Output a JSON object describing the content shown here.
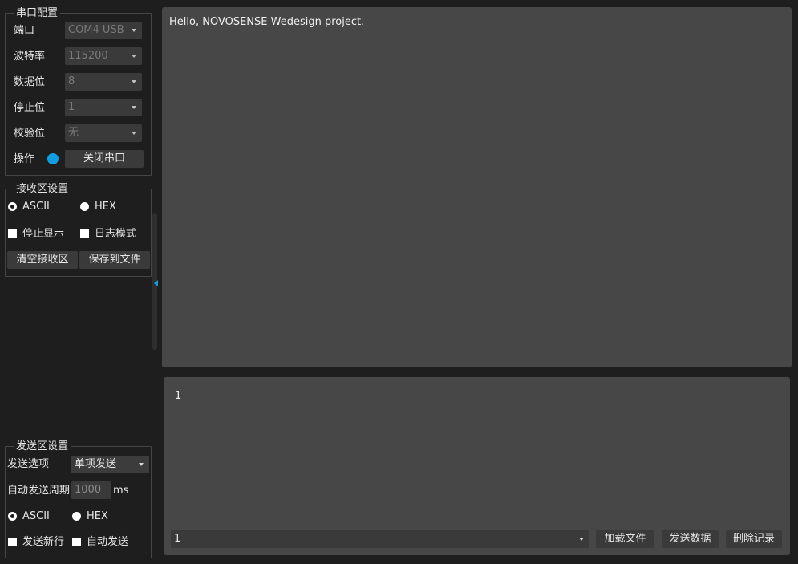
{
  "serial_config": {
    "title": "串口配置",
    "port_label": "端口",
    "port_value": "COM4 USB",
    "baud_label": "波特率",
    "baud_value": "115200",
    "databits_label": "数据位",
    "databits_value": "8",
    "stopbits_label": "停止位",
    "stopbits_value": "1",
    "parity_label": "校验位",
    "parity_value": "无",
    "operation_label": "操作",
    "close_port_button": "关闭串口",
    "status_color": "#119ee0"
  },
  "receive_settings": {
    "title": "接收区设置",
    "ascii_label": "ASCII",
    "hex_label": "HEX",
    "selected_mode": "ASCII",
    "stop_display_label": "停止显示",
    "log_mode_label": "日志模式",
    "clear_button": "清空接收区",
    "save_button": "保存到文件"
  },
  "send_settings": {
    "title": "发送区设置",
    "send_option_label": "发送选项",
    "send_option_value": "单项发送",
    "auto_period_label": "自动发送周期",
    "auto_period_value": "1000",
    "auto_period_unit": "ms",
    "ascii_label": "ASCII",
    "hex_label": "HEX",
    "selected_mode": "ASCII",
    "newline_label": "发送新行",
    "auto_send_label": "自动发送"
  },
  "receive_area": {
    "text": "Hello, NOVOSENSE Wedesign project."
  },
  "send_area": {
    "text": "1",
    "history_value": "1",
    "load_file_button": "加载文件",
    "send_button": "发送数据",
    "delete_button": "删除记录"
  }
}
